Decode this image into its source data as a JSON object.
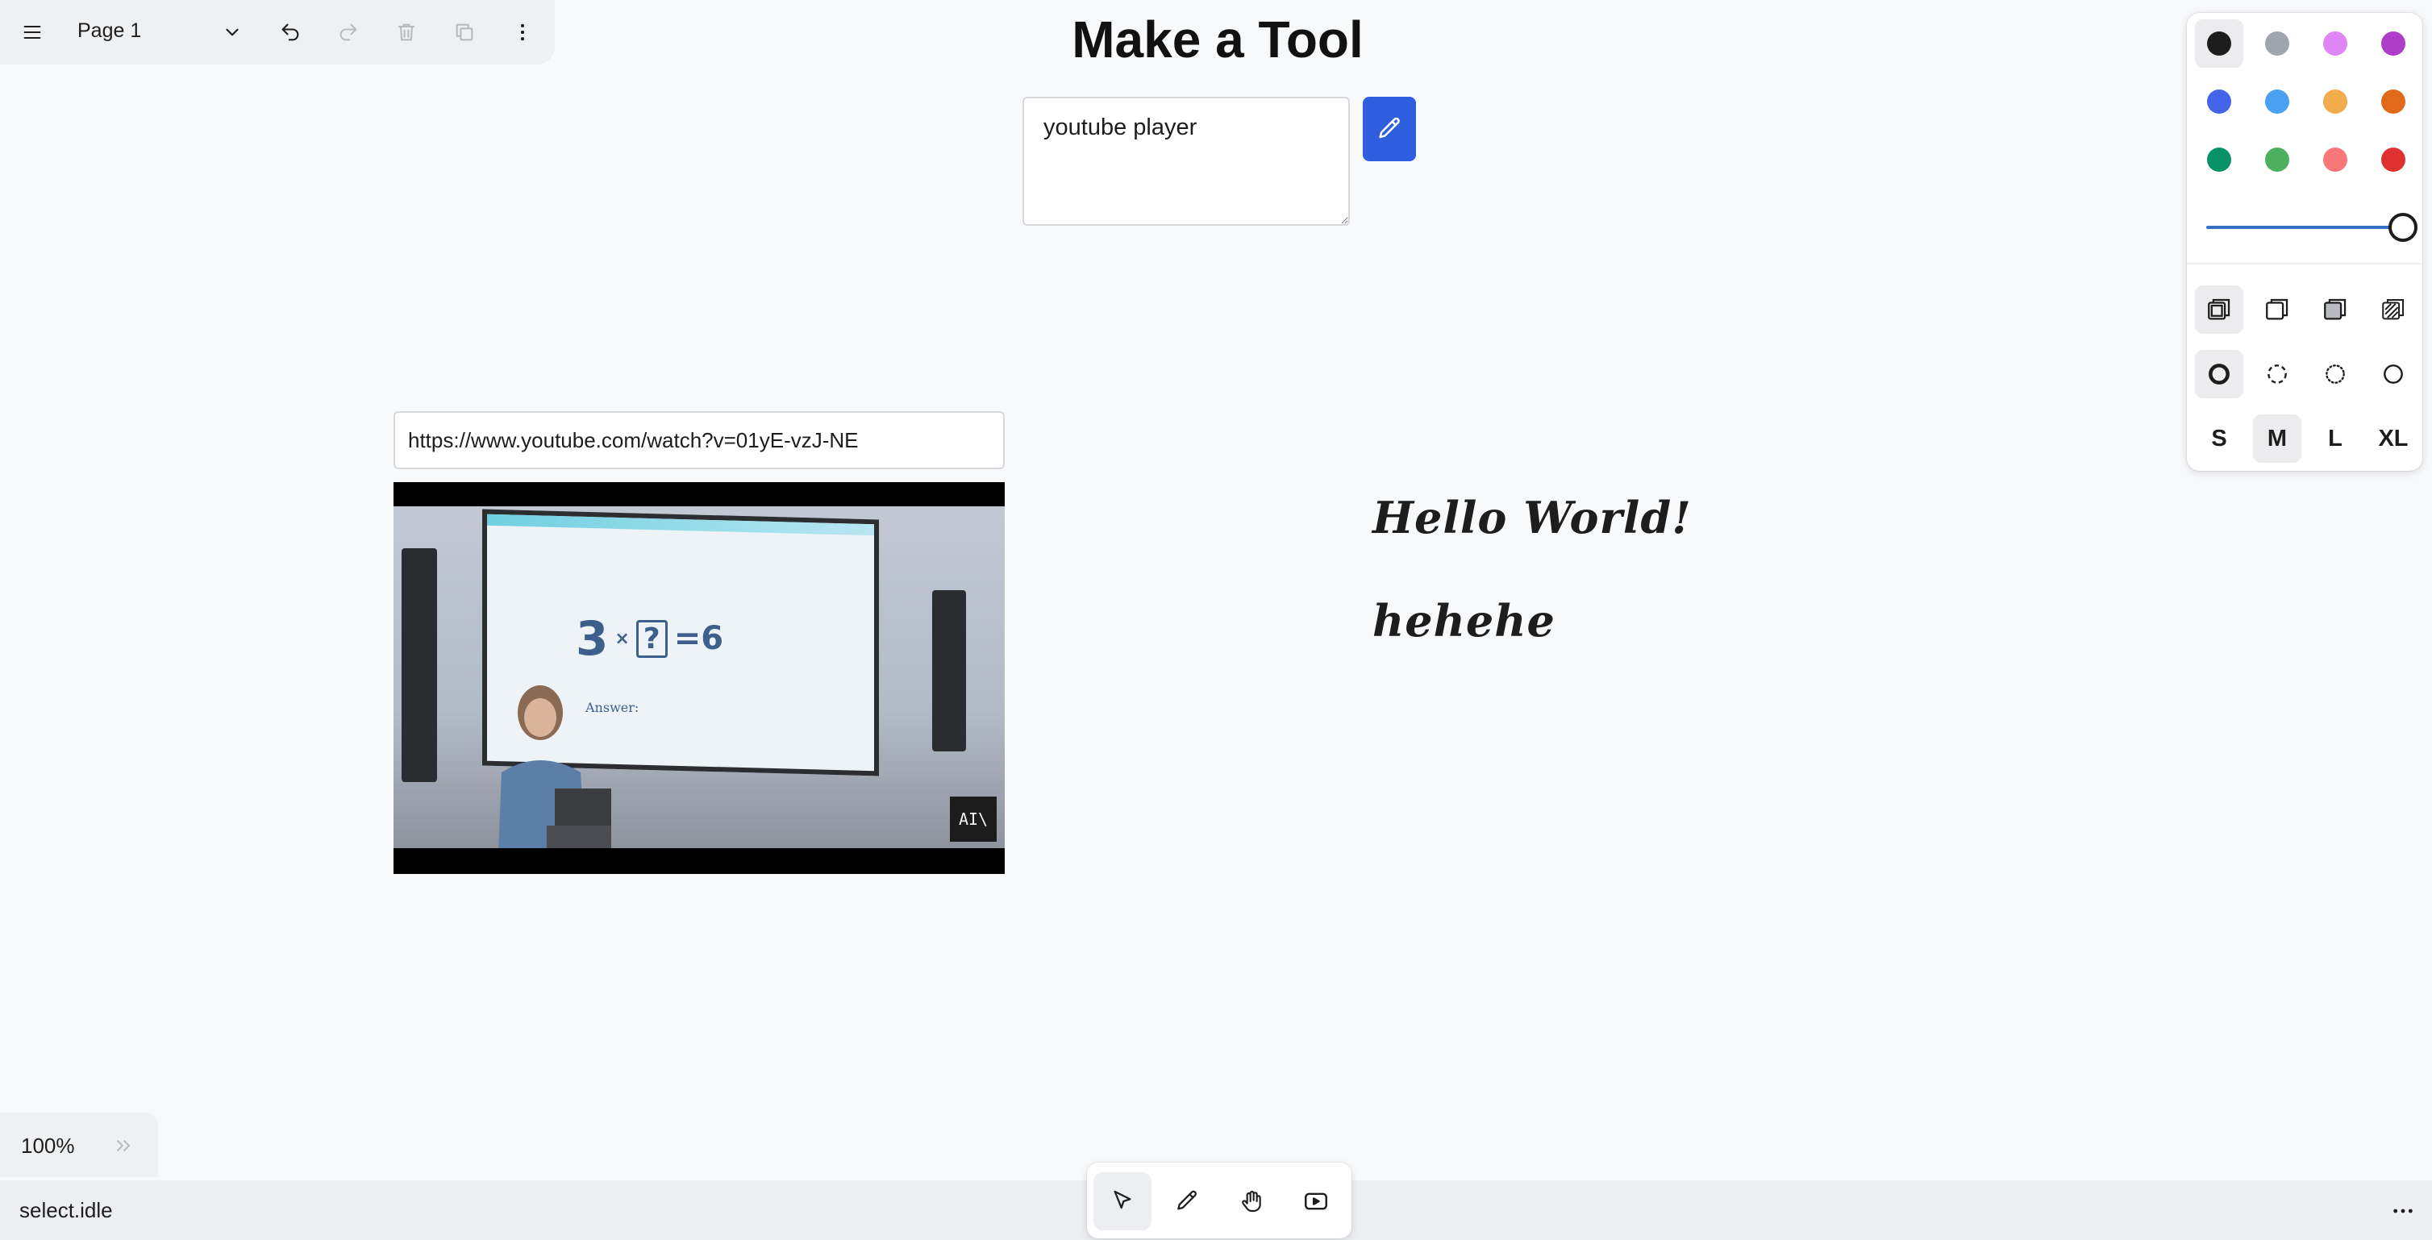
{
  "menu": {
    "page_name": "Page 1",
    "icons": [
      "hamburger-menu-icon",
      "chevron-down-icon",
      "undo-icon",
      "redo-icon",
      "trash-icon",
      "duplicate-icon",
      "more-vertical-icon"
    ]
  },
  "canvas": {
    "title": "Make a Tool",
    "prompt_value": "youtube player",
    "make_button_icon": "pencil-icon",
    "video_url": "https://www.youtube.com/watch?v=01yE-vzJ-NE",
    "video": {
      "equation_left": "3",
      "equation_times": "×",
      "equation_unknown": "?",
      "equation_right": "=6",
      "answer_label": "Answer:",
      "badge": "AI\\"
    },
    "text_shapes": [
      "Hello World!",
      "hehehe"
    ]
  },
  "style_panel": {
    "colors": [
      "#1d1d1d",
      "#9fa5ad",
      "#e085f4",
      "#ae3ec9",
      "#4465e9",
      "#4ba1f1",
      "#f1ac4b",
      "#e16919",
      "#099268",
      "#4cb05e",
      "#f87777",
      "#e03131"
    ],
    "selected_color_index": 0,
    "opacity": 1.0,
    "fill_options": [
      "fill-none-icon",
      "fill-semi-icon",
      "fill-solid-icon",
      "fill-pattern-icon"
    ],
    "selected_fill_index": 0,
    "dash_options": [
      "dash-draw-icon",
      "dash-dashed-icon",
      "dash-dotted-icon",
      "dash-solid-icon"
    ],
    "selected_dash_index": 0,
    "sizes": [
      "S",
      "M",
      "L",
      "XL"
    ],
    "selected_size_index": 1
  },
  "zoom": {
    "label": "100%"
  },
  "status": {
    "text": "select.idle"
  },
  "toolbar": {
    "tools": [
      "select-tool-icon",
      "draw-tool-icon",
      "hand-tool-icon",
      "video-tool-icon"
    ],
    "selected_index": 0
  }
}
